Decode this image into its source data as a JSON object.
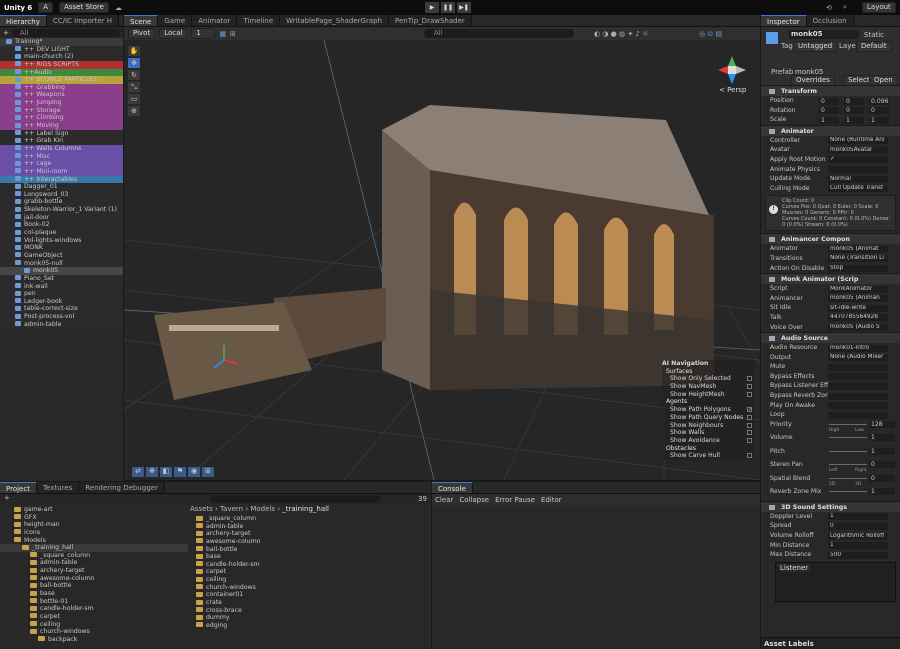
{
  "toolbar": {
    "app": "Unity 6",
    "account": "A",
    "store": "Asset Store",
    "layout": "Layout"
  },
  "top_tabs": {
    "hierarchy": "Hierarchy",
    "importer": "CC/IC Importer H",
    "scene": "Scene",
    "game": "Game",
    "animator": "Animator",
    "timeline": "Timeline",
    "writable": "WritablePage_ShaderGraph",
    "pentip": "PenTip_DrawShader",
    "inspector": "Inspector",
    "occlusion": "Occlusion"
  },
  "hierarchy": {
    "search_placeholder": "All",
    "items": [
      {
        "label": "Training*",
        "color": "#3a3a3a",
        "indent": 0
      },
      {
        "label": "++ DEV LIGHT",
        "color": "#2b2b2b",
        "indent": 1
      },
      {
        "label": "main-church (2)",
        "color": "#2b2b2b",
        "indent": 1
      },
      {
        "label": "++ RIGS SCRIPTS",
        "color": "#b03030",
        "indent": 1
      },
      {
        "label": "++Audio",
        "color": "#3d8a3d",
        "indent": 1
      },
      {
        "label": "++ SCONCE PARTICLES",
        "color": "#b8a23a",
        "indent": 1
      },
      {
        "label": "++ Grabbing",
        "color": "#8a3d8a",
        "indent": 1
      },
      {
        "label": "++ Weapons",
        "color": "#8a3d8a",
        "indent": 1
      },
      {
        "label": "++ Jumping",
        "color": "#8a3d8a",
        "indent": 1
      },
      {
        "label": "++ Storage",
        "color": "#8a3d8a",
        "indent": 1
      },
      {
        "label": "++ Climbing",
        "color": "#8a3d8a",
        "indent": 1
      },
      {
        "label": "++ Moving",
        "color": "#8a3d8a",
        "indent": 1
      },
      {
        "label": "++ Label Sign",
        "color": "#2b2b2b",
        "indent": 1
      },
      {
        "label": "++ Grab Kin",
        "color": "#2b2b2b",
        "indent": 1
      },
      {
        "label": "++ Walls Columns",
        "color": "#6a4fa8",
        "indent": 1
      },
      {
        "label": "++ Misc",
        "color": "#6a4fa8",
        "indent": 1
      },
      {
        "label": "++ cage",
        "color": "#6a4fa8",
        "indent": 1
      },
      {
        "label": "++ Mini-room",
        "color": "#6a4fa8",
        "indent": 1
      },
      {
        "label": "++ Interactables",
        "color": "#3a78a8",
        "indent": 1
      },
      {
        "label": "Dagger_01",
        "color": "#2b2b2b",
        "indent": 1
      },
      {
        "label": "Longsword_03",
        "color": "#2b2b2b",
        "indent": 1
      },
      {
        "label": "grabb-bottle",
        "color": "#2b2b2b",
        "indent": 1
      },
      {
        "label": "Skeleton-Warrior_1 Variant (1)",
        "color": "#2b2b2b",
        "indent": 1
      },
      {
        "label": "jail-door",
        "color": "#2b2b2b",
        "indent": 1
      },
      {
        "label": "Book-02",
        "color": "#2b2b2b",
        "indent": 1
      },
      {
        "label": "col-plaque",
        "color": "#2b2b2b",
        "indent": 1
      },
      {
        "label": "Vol-lights-windows",
        "color": "#2b2b2b",
        "indent": 1
      },
      {
        "label": "MONK",
        "color": "#2b2b2b",
        "indent": 1
      },
      {
        "label": "GameObject",
        "color": "#2b2b2b",
        "indent": 1
      },
      {
        "label": "monk05-null",
        "color": "#2b2b2b",
        "indent": 1
      },
      {
        "label": "monk05",
        "color": "#474747",
        "indent": 2
      },
      {
        "label": "Piano_Set",
        "color": "#2b2b2b",
        "indent": 1
      },
      {
        "label": "ink-wall",
        "color": "#2b2b2b",
        "indent": 1
      },
      {
        "label": "pen",
        "color": "#2b2b2b",
        "indent": 1
      },
      {
        "label": "Ledger-book",
        "color": "#2b2b2b",
        "indent": 1
      },
      {
        "label": "table-correct-size",
        "color": "#2b2b2b",
        "indent": 1
      },
      {
        "label": "Post-process-vol",
        "color": "#2b2b2b",
        "indent": 1
      },
      {
        "label": "admin-table",
        "color": "#2b2b2b",
        "indent": 1
      }
    ]
  },
  "scene": {
    "pivot": "Pivot",
    "local": "Local",
    "snap": "1",
    "search_placeholder": "All",
    "persp": "< Persp",
    "overlay": {
      "title": "AI Navigation",
      "sections": [
        {
          "header": "Surfaces",
          "items": [
            {
              "label": "Show Only Selected",
              "checked": false
            },
            {
              "label": "Show NavMesh",
              "checked": false
            },
            {
              "label": "Show HeightMesh",
              "checked": false
            }
          ]
        },
        {
          "header": "Agents",
          "items": [
            {
              "label": "Show Path Polygons",
              "checked": true
            },
            {
              "label": "Show Path Query Nodes",
              "checked": false
            },
            {
              "label": "Show Neighbours",
              "checked": false
            },
            {
              "label": "Show Walls",
              "checked": false
            },
            {
              "label": "Show Avoidance",
              "checked": false
            }
          ]
        },
        {
          "header": "Obstacles",
          "items": [
            {
              "label": "Show Carve Hull",
              "checked": false
            }
          ]
        }
      ]
    }
  },
  "inspector": {
    "object_name": "monk05",
    "static": "Static",
    "tag_label": "Tag",
    "tag": "Untagged",
    "layer_label": "Layer",
    "layer": "Default",
    "prefab_label": "Prefab",
    "prefab": "monk05",
    "overrides": "Overrides",
    "select": "Select",
    "open": "Open",
    "transform": {
      "title": "Transform",
      "rows": [
        {
          "label": "Position",
          "x": "0",
          "y": "0",
          "z": "0.096"
        },
        {
          "label": "Rotation",
          "x": "0",
          "y": "0",
          "z": "0"
        },
        {
          "label": "Scale",
          "x": "1",
          "y": "1",
          "z": "1"
        }
      ]
    },
    "animator": {
      "title": "Animator",
      "rows": [
        {
          "label": "Controller",
          "value": "None (Runtime Ani"
        },
        {
          "label": "Avatar",
          "value": "monk05Avatar"
        },
        {
          "label": "Apply Root Motion",
          "value": "✓"
        },
        {
          "label": "Animate Physics",
          "value": ""
        },
        {
          "label": "Update Mode",
          "value": "Normal"
        },
        {
          "label": "Culling Mode",
          "value": "Cull Update Transf"
        }
      ],
      "info": [
        "Clip Count: 0",
        "Curves Pos: 0 Quat: 0 Euler: 0 Scale: 0",
        "Muscles: 0 Generic: 0 PPtr: 0",
        "Curves Count: 0 Constant: 0 (0.0%) Dense:",
        "0 (0.0%) Stream: 0 (0.0%)"
      ]
    },
    "animancer": {
      "title": "Animancer Compon",
      "rows": [
        {
          "label": "Animator",
          "value": "monk05 (Animat"
        },
        {
          "label": "Transitions",
          "value": "None (Transition Li"
        },
        {
          "label": "Action On Disable",
          "value": "Stop"
        }
      ]
    },
    "monk": {
      "title": "Monk Animator (Scrip",
      "rows": [
        {
          "label": "Script",
          "value": "MonkAnimator"
        },
        {
          "label": "Animancer",
          "value": "monk05 (Animan"
        },
        {
          "label": "Sit Idle",
          "value": "sit-idle-write"
        },
        {
          "label": "Talk",
          "value": "4470785564928"
        },
        {
          "label": "Voice Over",
          "value": "monk05 (Audio S"
        }
      ]
    },
    "audio": {
      "title": "Audio Source",
      "rows": [
        {
          "label": "Audio Resource",
          "value": "monk01-intro"
        },
        {
          "label": "Output",
          "value": "None (Audio Mixer"
        },
        {
          "label": "Mute",
          "value": ""
        },
        {
          "label": "Bypass Effects",
          "value": ""
        },
        {
          "label": "Bypass Listener Effe",
          "value": ""
        },
        {
          "label": "Bypass Reverb Zone",
          "value": ""
        },
        {
          "label": "Play On Awake",
          "value": ""
        },
        {
          "label": "Loop",
          "value": ""
        }
      ],
      "sliders": [
        {
          "label": "Priority",
          "value": "128",
          "lo": "High",
          "hi": "Low"
        },
        {
          "label": "Volume",
          "value": "1",
          "lo": "",
          "hi": ""
        },
        {
          "label": "Pitch",
          "value": "1",
          "lo": "",
          "hi": ""
        },
        {
          "label": "Stereo Pan",
          "value": "0",
          "lo": "Left",
          "hi": "Right"
        },
        {
          "label": "Spatial Blend",
          "value": "0",
          "lo": "2D",
          "hi": "3D"
        },
        {
          "label": "Reverb Zone Mix",
          "value": "1",
          "lo": "",
          "hi": ""
        }
      ]
    },
    "sound3d": {
      "title": "3D Sound Settings",
      "rows": [
        {
          "label": "Doppler Level",
          "value": "1"
        },
        {
          "label": "Spread",
          "value": "0"
        },
        {
          "label": "Volume Rolloff",
          "value": "Logarithmic Rolloff"
        },
        {
          "label": "Min Distance",
          "value": "1"
        },
        {
          "label": "Max Distance",
          "value": "500"
        }
      ],
      "listener": "Listener"
    },
    "asset_labels": "Asset Labels"
  },
  "bottom_tabs": {
    "project": "Project",
    "textures": "Textures",
    "rendering": "Rendering Debugger",
    "console": "Console"
  },
  "console": {
    "clear": "Clear",
    "collapse": "Collapse",
    "error_pause": "Error Pause",
    "editor": "Editor"
  },
  "project": {
    "count": "39",
    "breadcrumb": [
      "Assets",
      "Tavern",
      "Models",
      "_training_hall"
    ],
    "tree": [
      {
        "label": "game-art",
        "indent": 1
      },
      {
        "label": "GFX",
        "indent": 1
      },
      {
        "label": "height-man",
        "indent": 1
      },
      {
        "label": "icons",
        "indent": 1
      },
      {
        "label": "Models",
        "indent": 1
      },
      {
        "label": "_training_hall",
        "indent": 2
      },
      {
        "label": "_square_column",
        "indent": 3
      },
      {
        "label": "admin-table",
        "indent": 3
      },
      {
        "label": "archery-target",
        "indent": 3
      },
      {
        "label": "awesome-column",
        "indent": 3
      },
      {
        "label": "ball-bottle",
        "indent": 3
      },
      {
        "label": "base",
        "indent": 3
      },
      {
        "label": "bottle-01",
        "indent": 3
      },
      {
        "label": "candle-holder-sm",
        "indent": 3
      },
      {
        "label": "carpet",
        "indent": 3
      },
      {
        "label": "ceiling",
        "indent": 3
      },
      {
        "label": "church-windows",
        "indent": 3
      },
      {
        "label": "backpack",
        "indent": 4
      }
    ],
    "files": [
      "_square_column",
      "admin-table",
      "archery-target",
      "awesome-column",
      "ball-bottle",
      "base",
      "candle-holder-sm",
      "carpet",
      "ceiling",
      "church-windows",
      "container01",
      "crate",
      "cross-brace",
      "dummy",
      "edging"
    ]
  }
}
